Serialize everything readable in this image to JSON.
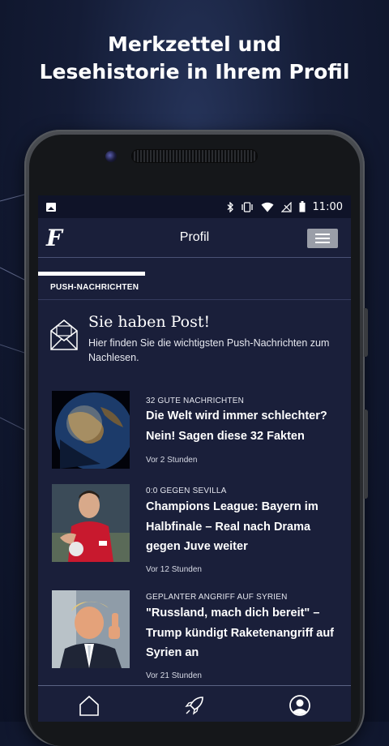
{
  "headline": {
    "line1": "Merkzettel und",
    "line2": "Lesehistorie in Ihrem Profil"
  },
  "statusbar": {
    "time": "11:00",
    "icons": [
      "image-icon",
      "bluetooth-icon",
      "vibrate-icon",
      "wifi-icon",
      "no-signal-icon",
      "battery-icon"
    ]
  },
  "appbar": {
    "logo": "F",
    "title": "Profil",
    "menu_icon": "hamburger-icon"
  },
  "section": {
    "label": "PUSH-NACHRICHTEN"
  },
  "post": {
    "icon": "envelope-icon",
    "title": "Sie haben Post!",
    "text": "Hier finden Sie die wichtigsten Push-Nachrichten zum Nachlesen."
  },
  "articles": [
    {
      "kicker": "32 GUTE NACHRICHTEN",
      "title": "Die Welt wird immer schlechter? Nein! Sagen diese 32 Fakten",
      "time": "Vor 2 Stunden",
      "image": "earth-photo"
    },
    {
      "kicker": "0:0 GEGEN SEVILLA",
      "title": "Champions League: Bayern im Halbfinale – Real nach Drama gegen Juve weiter",
      "time": "Vor 12 Stunden",
      "image": "football-player-photo"
    },
    {
      "kicker": "GEPLANTER ANGRIFF AUF SYRIEN",
      "title": "\"Russland, mach dich bereit\" – Trump kündigt Raketenangriff auf Syrien an",
      "time": "Vor 21 Stunden",
      "image": "politician-photo"
    }
  ],
  "bottomnav": {
    "items": [
      "home-icon",
      "rocket-icon",
      "profile-icon"
    ]
  },
  "colors": {
    "screen_bg": "#1a1f3a",
    "statusbar_bg": "#0f1328",
    "menu_button": "#9a9ea8"
  }
}
